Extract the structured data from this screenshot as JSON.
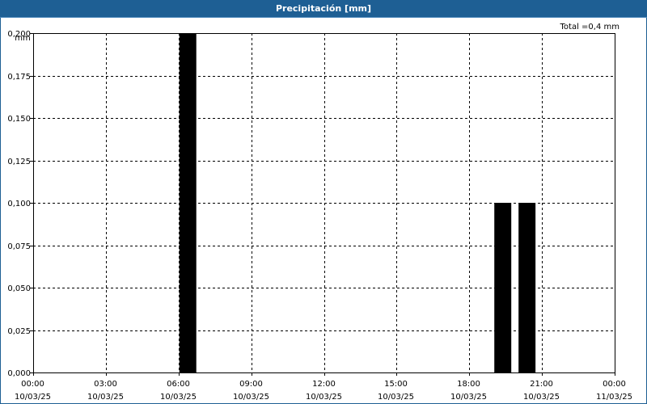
{
  "window": {
    "title": "Precipitación [mm]"
  },
  "colors": {
    "titlebar_bg": "#1e5f94",
    "bar_fill": "#000000",
    "grid": "#000000"
  },
  "chart_data": {
    "type": "bar",
    "title": "Precipitación [mm]",
    "unit_label": "mm",
    "total_label": "Total =0,4 mm",
    "ylim": [
      0,
      0.2
    ],
    "yticks": [
      "0,000",
      "0,025",
      "0,050",
      "0,075",
      "0,100",
      "0,125",
      "0,150",
      "0,175",
      "0,200"
    ],
    "xlim_hours": [
      0,
      24
    ],
    "xticks": [
      {
        "time": "00:00",
        "date": "10/03/25"
      },
      {
        "time": "03:00",
        "date": "10/03/25"
      },
      {
        "time": "06:00",
        "date": "10/03/25"
      },
      {
        "time": "09:00",
        "date": "10/03/25"
      },
      {
        "time": "12:00",
        "date": "10/03/25"
      },
      {
        "time": "15:00",
        "date": "10/03/25"
      },
      {
        "time": "18:00",
        "date": "10/03/25"
      },
      {
        "time": "21:00",
        "date": "10/03/25"
      },
      {
        "time": "00:00",
        "date": "11/03/25"
      }
    ],
    "bars": [
      {
        "time": "06:00",
        "value": 0.2
      },
      {
        "time": "19:00",
        "value": 0.1
      },
      {
        "time": "20:00",
        "value": 0.1
      }
    ],
    "grid": true,
    "grid_style": "dashed"
  }
}
